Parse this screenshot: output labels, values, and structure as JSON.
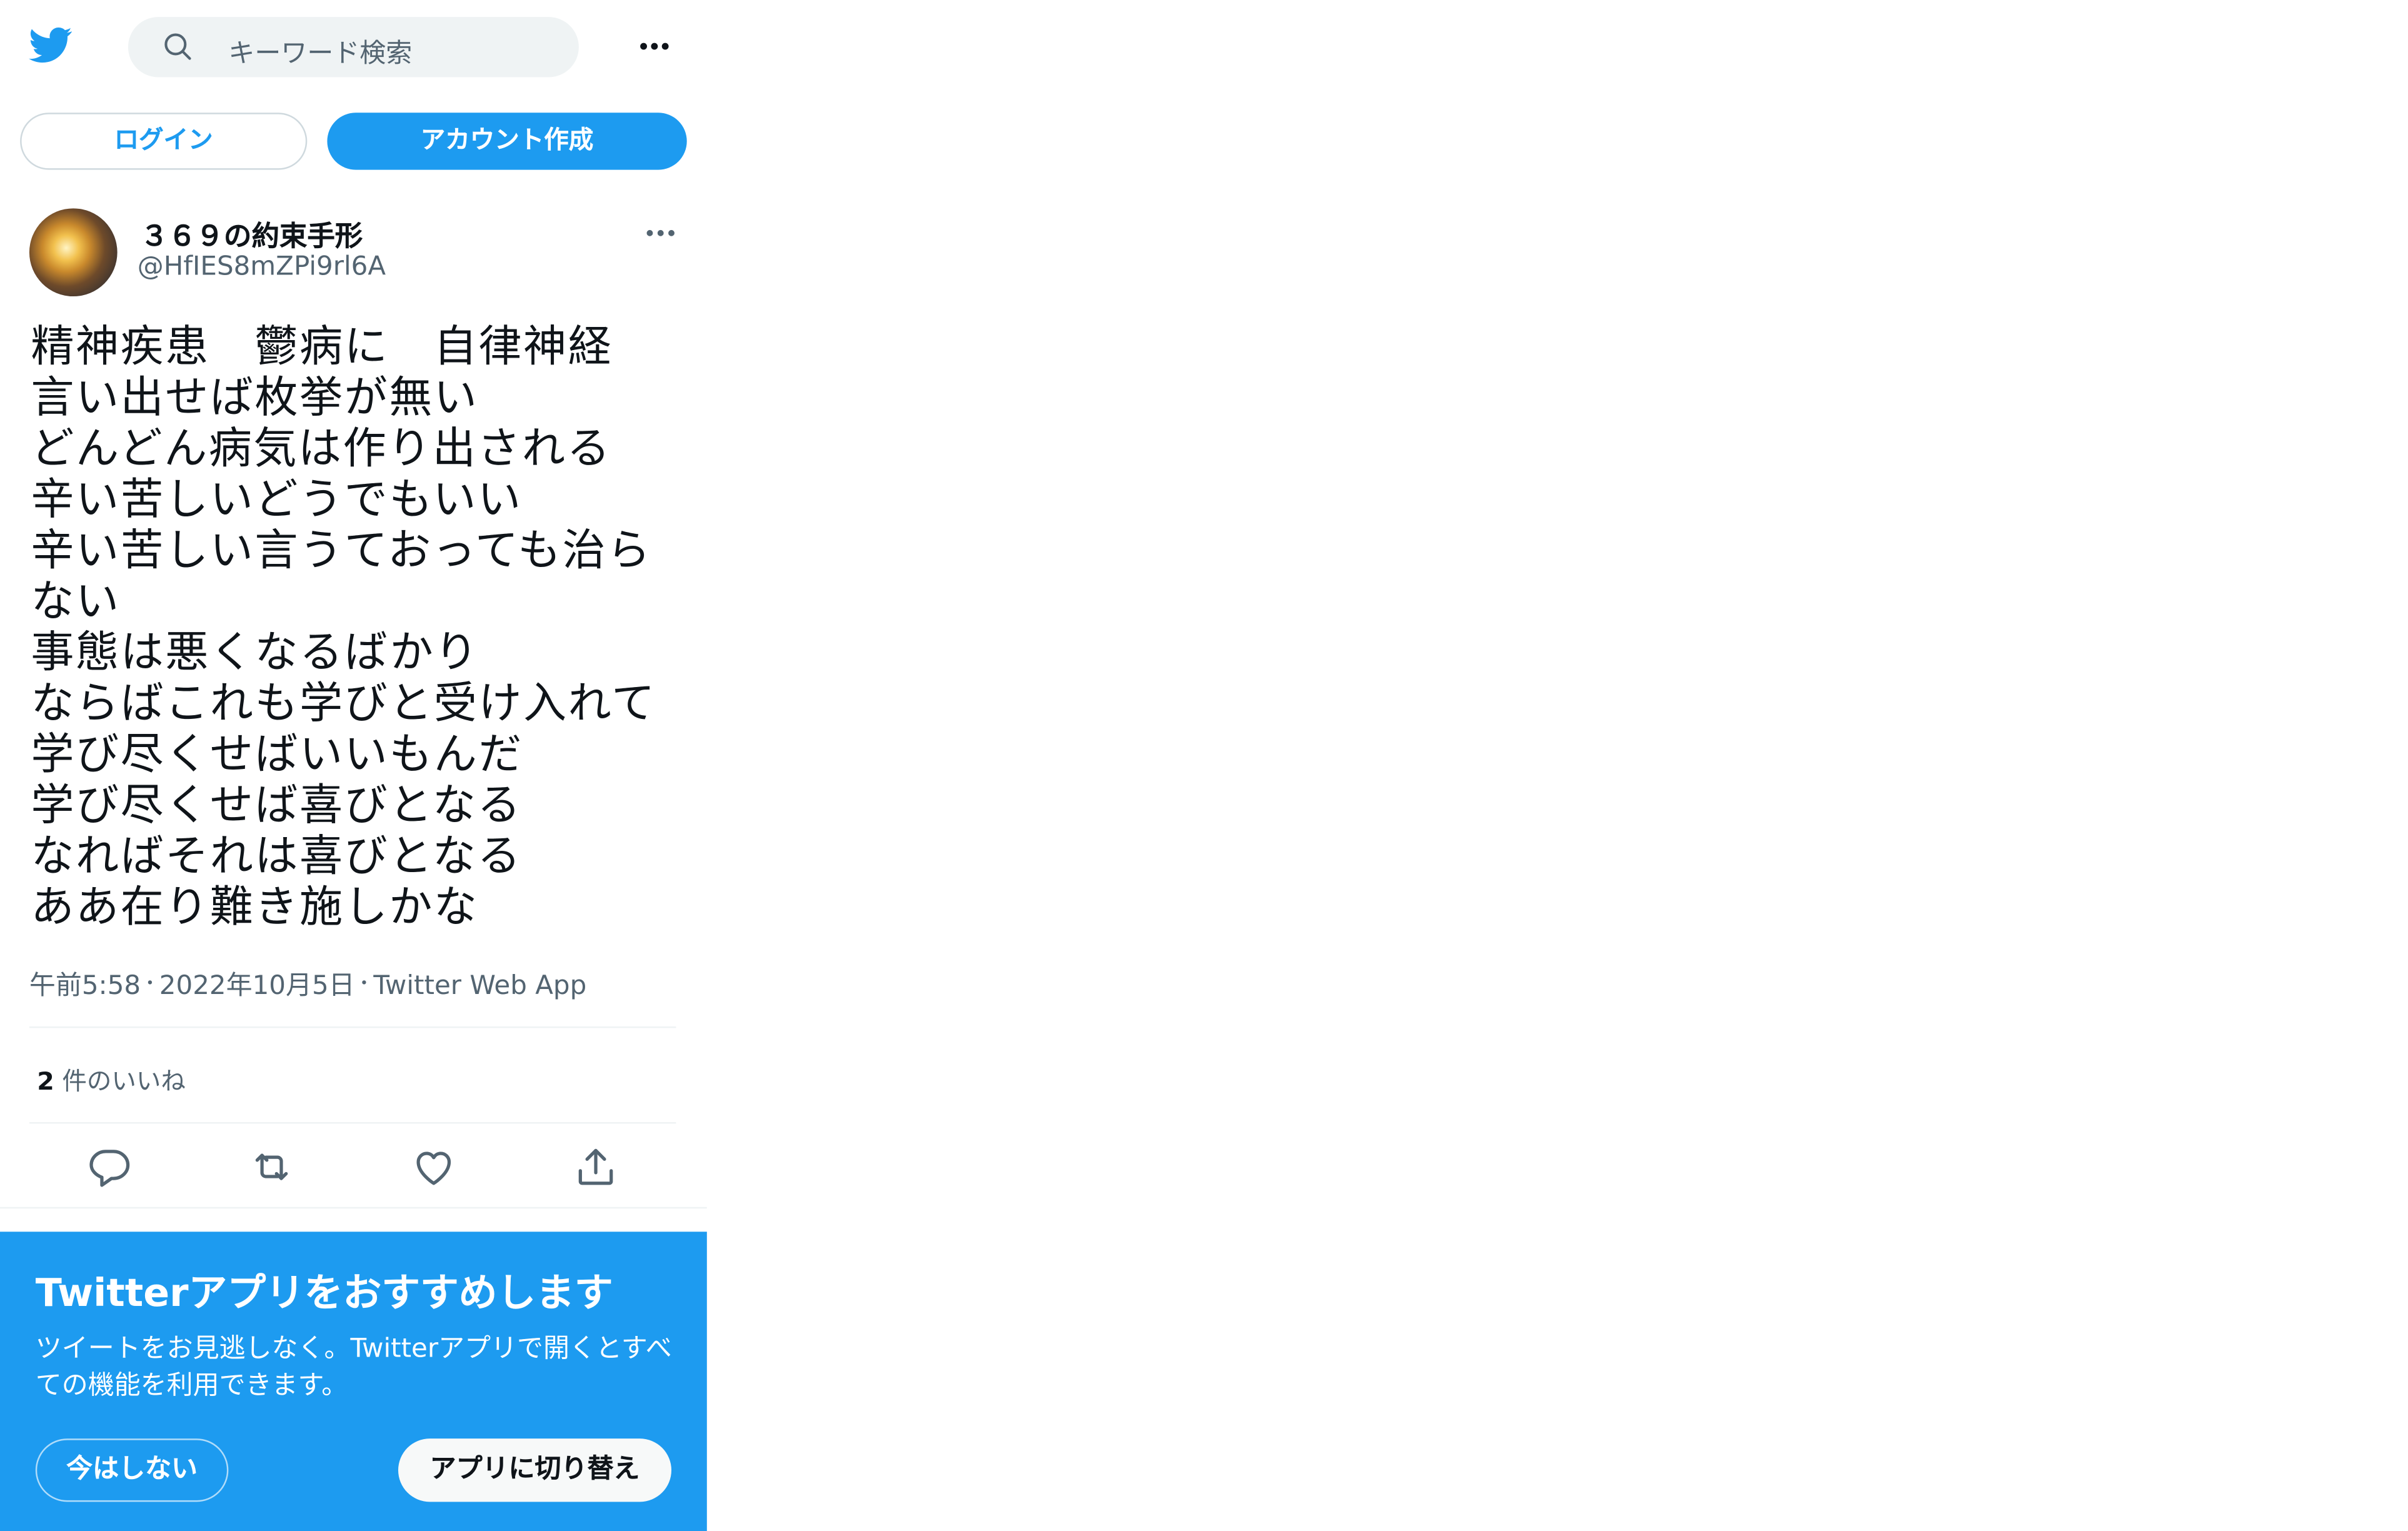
{
  "header": {
    "search_placeholder": "キーワード検索"
  },
  "auth": {
    "login_label": "ログイン",
    "signup_label": "アカウント作成"
  },
  "tweet": {
    "display_name": "３６９の約束手形",
    "handle": "@HfIES8mZPi9rl6A",
    "text": "精神疾患　鬱病に　自律神経\n言い出せば枚挙が無い\nどんどん病気は作り出される\n辛い苦しいどうでもいい\n辛い苦しい言うておっても治らない\n事態は悪くなるばかり\nならばこれも学びと受け入れて\n学び尽くせばいいもんだ\n学び尽くせば喜びとなる\nなればそれは喜びとなる\nああ在り難き施しかな",
    "time": "午前5:58",
    "date": "2022年10月5日",
    "source": "Twitter Web App",
    "separator": "・",
    "likes_count": "2",
    "likes_label": "件のいいね"
  },
  "actions": {
    "icons": [
      "reply-icon",
      "retweet-icon",
      "like-icon",
      "share-icon"
    ]
  },
  "promo": {
    "title": "Twitterアプリをおすすめします",
    "body": "ツイートをお見逃しなく。Twitterアプリで開くとすべての機能を利用できます。",
    "not_now_label": "今はしない",
    "switch_label": "アプリに切り替え"
  },
  "colors": {
    "brand": "#1d9bf0",
    "text_primary": "#0f1419",
    "text_secondary": "#536471",
    "divider": "#eff3f4"
  }
}
